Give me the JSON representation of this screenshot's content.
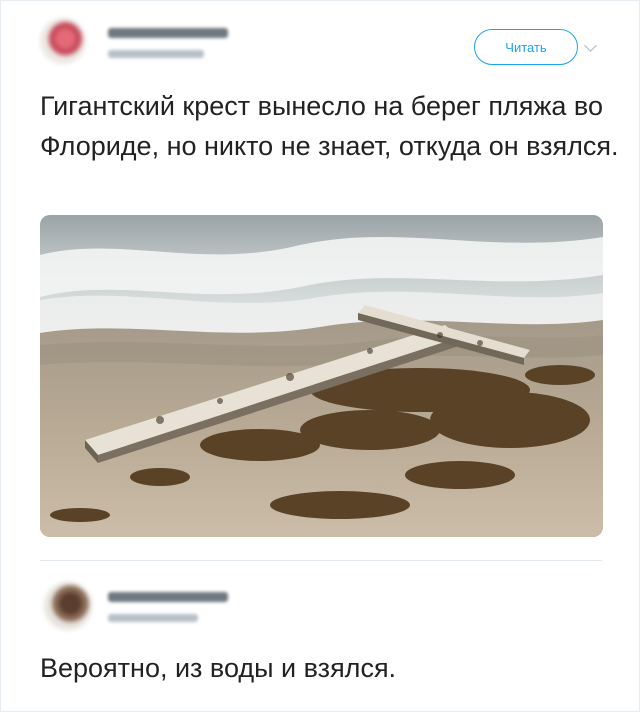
{
  "tweet": {
    "follow_label": "Читать",
    "text": "Гигантский крест вынесло на берег пляжа во Флориде, но никто не знает, откуда он взялся."
  },
  "reply": {
    "text": "Вероятно, из воды и взялся."
  },
  "icons": {
    "chevron": "chevron-down-icon"
  },
  "colors": {
    "accent": "#1da1f2",
    "text": "#14171a",
    "divider": "#e1e8ed"
  }
}
